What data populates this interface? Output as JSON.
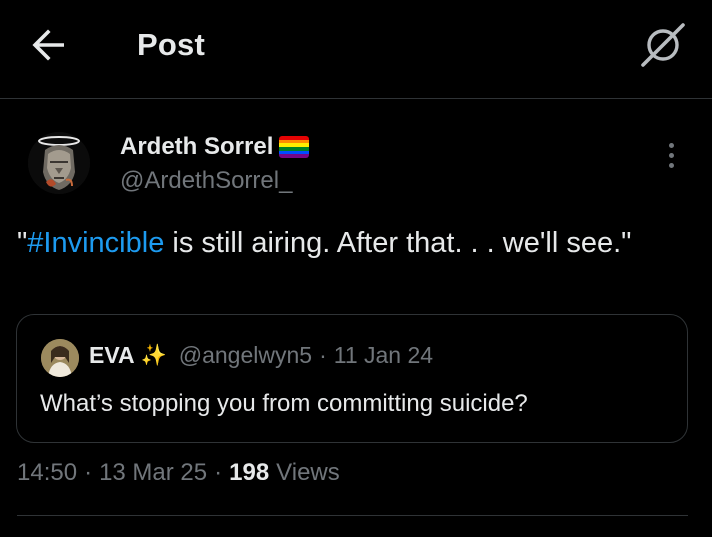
{
  "header": {
    "title": "Post",
    "back_icon": "arrow-left-icon",
    "grok_icon": "grok-icon"
  },
  "post": {
    "author_name": "Ardeth Sorrel",
    "author_badge": "rainbow-flag-emoji",
    "author_handle": "@ArdethSorrel_",
    "text_open_quote": "\"",
    "hashtag": "#Invincible",
    "text_rest": " is still airing. After that. . . we'll see.\"",
    "more_icon": "more-vertical-icon"
  },
  "quote": {
    "name": "EVA",
    "sparkle": "✨",
    "handle": "@angelwyn5",
    "separator": "·",
    "date": "11 Jan 24",
    "text": "What’s stopping you from committing suicide?"
  },
  "meta": {
    "time": "14:50",
    "separator": "·",
    "date": "13 Mar 25",
    "views_count": "198",
    "views_label": "Views"
  },
  "colors": {
    "background": "#000000",
    "primary_text": "#e7e9ea",
    "secondary_text": "#71767b",
    "link": "#1d9bf0",
    "border": "#2f3336"
  }
}
